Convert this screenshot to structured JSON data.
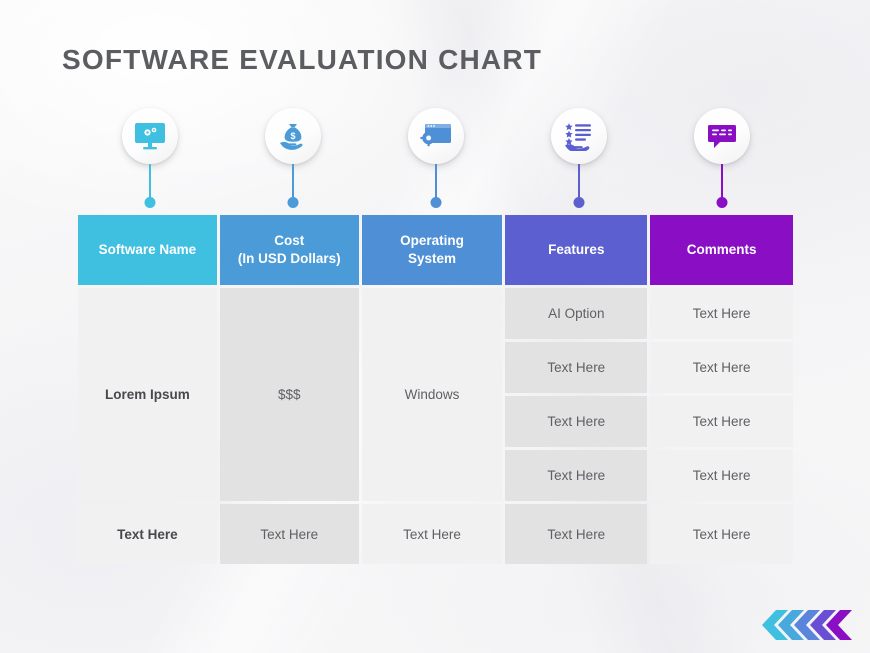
{
  "title": "SOFTWARE EVALUATION CHART",
  "theme": {
    "title_color": "#5b5d61",
    "page_background": "#f7f7f8",
    "cell_light": "#f1f1f2",
    "cell_dark": "#e2e2e3",
    "cell_text": "#5e6064"
  },
  "badges": [
    {
      "icon": "monitor-gears-icon",
      "color": "#3fc0e0",
      "label": "Software Name"
    },
    {
      "icon": "hand-money-bag-icon",
      "color": "#4a9bd8",
      "label": "Cost"
    },
    {
      "icon": "window-gear-icon",
      "color": "#4f8fd6",
      "label": "Operating System"
    },
    {
      "icon": "hand-rating-list-icon",
      "color": "#5b5fd0",
      "label": "Features"
    },
    {
      "icon": "speech-bubble-icon",
      "color": "#8a0fc4",
      "label": "Comments"
    }
  ],
  "table": {
    "headers": [
      {
        "line1": "Software Name",
        "line2": "",
        "color": "#3fc0e0"
      },
      {
        "line1": "Cost",
        "line2": "(In USD Dollars)",
        "color": "#4a9bd8"
      },
      {
        "line1": "Operating",
        "line2": "System",
        "color": "#4f8fd6"
      },
      {
        "line1": "Features",
        "line2": "",
        "color": "#5b5fd0"
      },
      {
        "line1": "Comments",
        "line2": "",
        "color": "#8a0fc4"
      }
    ],
    "main_row": {
      "software_name": "Lorem Ipsum",
      "cost": "$$$",
      "operating_system": "Windows",
      "features": [
        "AI Option",
        "Text Here",
        "Text Here",
        "Text Here"
      ],
      "comments": [
        "Text Here",
        "Text Here",
        "Text Here",
        "Text Here"
      ]
    },
    "last_row": {
      "software_name": "Text Here",
      "cost": "Text Here",
      "operating_system": "Text Here",
      "features": "Text Here",
      "comments": "Text Here"
    }
  },
  "logo": {
    "name": "chevron-logo",
    "colors": [
      "#3fc0e0",
      "#49a8dd",
      "#5b85dc",
      "#6a4fd4",
      "#8a0fc4"
    ]
  }
}
